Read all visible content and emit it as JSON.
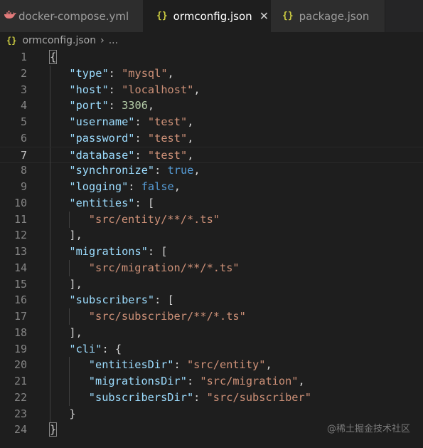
{
  "tabs": [
    {
      "label": "docker-compose.yml",
      "icon": "docker-whale-icon",
      "active": false
    },
    {
      "label": "ormconfig.json",
      "icon": "json-braces-icon",
      "active": true,
      "close": "✕"
    },
    {
      "label": "package.json",
      "icon": "json-braces-icon",
      "active": false
    }
  ],
  "icon_glyph": "{}",
  "breadcrumb": {
    "file": "ormconfig.json",
    "separator": "›",
    "trail": "..."
  },
  "editor": {
    "current_line": 7,
    "lines": [
      {
        "num": "1",
        "indent": 0,
        "tokens": [
          {
            "t": "{",
            "c": "brace"
          }
        ]
      },
      {
        "num": "2",
        "indent": 1,
        "tokens": [
          {
            "t": "\"type\"",
            "c": "k"
          },
          {
            "t": ": ",
            "c": "p"
          },
          {
            "t": "\"mysql\"",
            "c": "s"
          },
          {
            "t": ",",
            "c": "p"
          }
        ]
      },
      {
        "num": "3",
        "indent": 1,
        "tokens": [
          {
            "t": "\"host\"",
            "c": "k"
          },
          {
            "t": ": ",
            "c": "p"
          },
          {
            "t": "\"localhost\"",
            "c": "s"
          },
          {
            "t": ",",
            "c": "p"
          }
        ]
      },
      {
        "num": "4",
        "indent": 1,
        "tokens": [
          {
            "t": "\"port\"",
            "c": "k"
          },
          {
            "t": ": ",
            "c": "p"
          },
          {
            "t": "3306",
            "c": "n"
          },
          {
            "t": ",",
            "c": "p"
          }
        ]
      },
      {
        "num": "5",
        "indent": 1,
        "tokens": [
          {
            "t": "\"username\"",
            "c": "k"
          },
          {
            "t": ": ",
            "c": "p"
          },
          {
            "t": "\"test\"",
            "c": "s"
          },
          {
            "t": ",",
            "c": "p"
          }
        ]
      },
      {
        "num": "6",
        "indent": 1,
        "tokens": [
          {
            "t": "\"password\"",
            "c": "k"
          },
          {
            "t": ": ",
            "c": "p"
          },
          {
            "t": "\"test\"",
            "c": "s"
          },
          {
            "t": ",",
            "c": "p"
          }
        ]
      },
      {
        "num": "7",
        "indent": 1,
        "tokens": [
          {
            "t": "\"database\"",
            "c": "k"
          },
          {
            "t": ": ",
            "c": "p"
          },
          {
            "t": "\"test\"",
            "c": "s"
          },
          {
            "t": ",",
            "c": "p"
          }
        ]
      },
      {
        "num": "8",
        "indent": 1,
        "tokens": [
          {
            "t": "\"synchronize\"",
            "c": "k"
          },
          {
            "t": ": ",
            "c": "p"
          },
          {
            "t": "true",
            "c": "b"
          },
          {
            "t": ",",
            "c": "p"
          }
        ]
      },
      {
        "num": "9",
        "indent": 1,
        "tokens": [
          {
            "t": "\"logging\"",
            "c": "k"
          },
          {
            "t": ": ",
            "c": "p"
          },
          {
            "t": "false",
            "c": "b"
          },
          {
            "t": ",",
            "c": "p"
          }
        ]
      },
      {
        "num": "10",
        "indent": 1,
        "tokens": [
          {
            "t": "\"entities\"",
            "c": "k"
          },
          {
            "t": ": [",
            "c": "p"
          }
        ]
      },
      {
        "num": "11",
        "indent": 2,
        "tokens": [
          {
            "t": "\"src/entity/**/*.ts\"",
            "c": "s"
          }
        ]
      },
      {
        "num": "12",
        "indent": 1,
        "tokens": [
          {
            "t": "],",
            "c": "p"
          }
        ]
      },
      {
        "num": "13",
        "indent": 1,
        "tokens": [
          {
            "t": "\"migrations\"",
            "c": "k"
          },
          {
            "t": ": [",
            "c": "p"
          }
        ]
      },
      {
        "num": "14",
        "indent": 2,
        "tokens": [
          {
            "t": "\"src/migration/**/*.ts\"",
            "c": "s"
          }
        ]
      },
      {
        "num": "15",
        "indent": 1,
        "tokens": [
          {
            "t": "],",
            "c": "p"
          }
        ]
      },
      {
        "num": "16",
        "indent": 1,
        "tokens": [
          {
            "t": "\"subscribers\"",
            "c": "k"
          },
          {
            "t": ": [",
            "c": "p"
          }
        ]
      },
      {
        "num": "17",
        "indent": 2,
        "tokens": [
          {
            "t": "\"src/subscriber/**/*.ts\"",
            "c": "s"
          }
        ]
      },
      {
        "num": "18",
        "indent": 1,
        "tokens": [
          {
            "t": "],",
            "c": "p"
          }
        ]
      },
      {
        "num": "19",
        "indent": 1,
        "tokens": [
          {
            "t": "\"cli\"",
            "c": "k"
          },
          {
            "t": ": {",
            "c": "p"
          }
        ]
      },
      {
        "num": "20",
        "indent": 2,
        "tokens": [
          {
            "t": "\"entitiesDir\"",
            "c": "k"
          },
          {
            "t": ": ",
            "c": "p"
          },
          {
            "t": "\"src/entity\"",
            "c": "s"
          },
          {
            "t": ",",
            "c": "p"
          }
        ]
      },
      {
        "num": "21",
        "indent": 2,
        "tokens": [
          {
            "t": "\"migrationsDir\"",
            "c": "k"
          },
          {
            "t": ": ",
            "c": "p"
          },
          {
            "t": "\"src/migration\"",
            "c": "s"
          },
          {
            "t": ",",
            "c": "p"
          }
        ]
      },
      {
        "num": "22",
        "indent": 2,
        "tokens": [
          {
            "t": "\"subscribersDir\"",
            "c": "k"
          },
          {
            "t": ": ",
            "c": "p"
          },
          {
            "t": "\"src/subscriber\"",
            "c": "s"
          }
        ]
      },
      {
        "num": "23",
        "indent": 1,
        "tokens": [
          {
            "t": "}",
            "c": "p"
          }
        ]
      },
      {
        "num": "24",
        "indent": 0,
        "tokens": [
          {
            "t": "}",
            "c": "brace"
          }
        ]
      }
    ]
  },
  "colors": {
    "background": "#1e1e1e",
    "key": "#9cdcfe",
    "string": "#ce9178",
    "number": "#b5cea8",
    "boolean": "#569cd6",
    "json_icon": "#cbcb41",
    "docker_icon": "#e37b7b"
  },
  "watermark": "@稀土掘金技术社区"
}
